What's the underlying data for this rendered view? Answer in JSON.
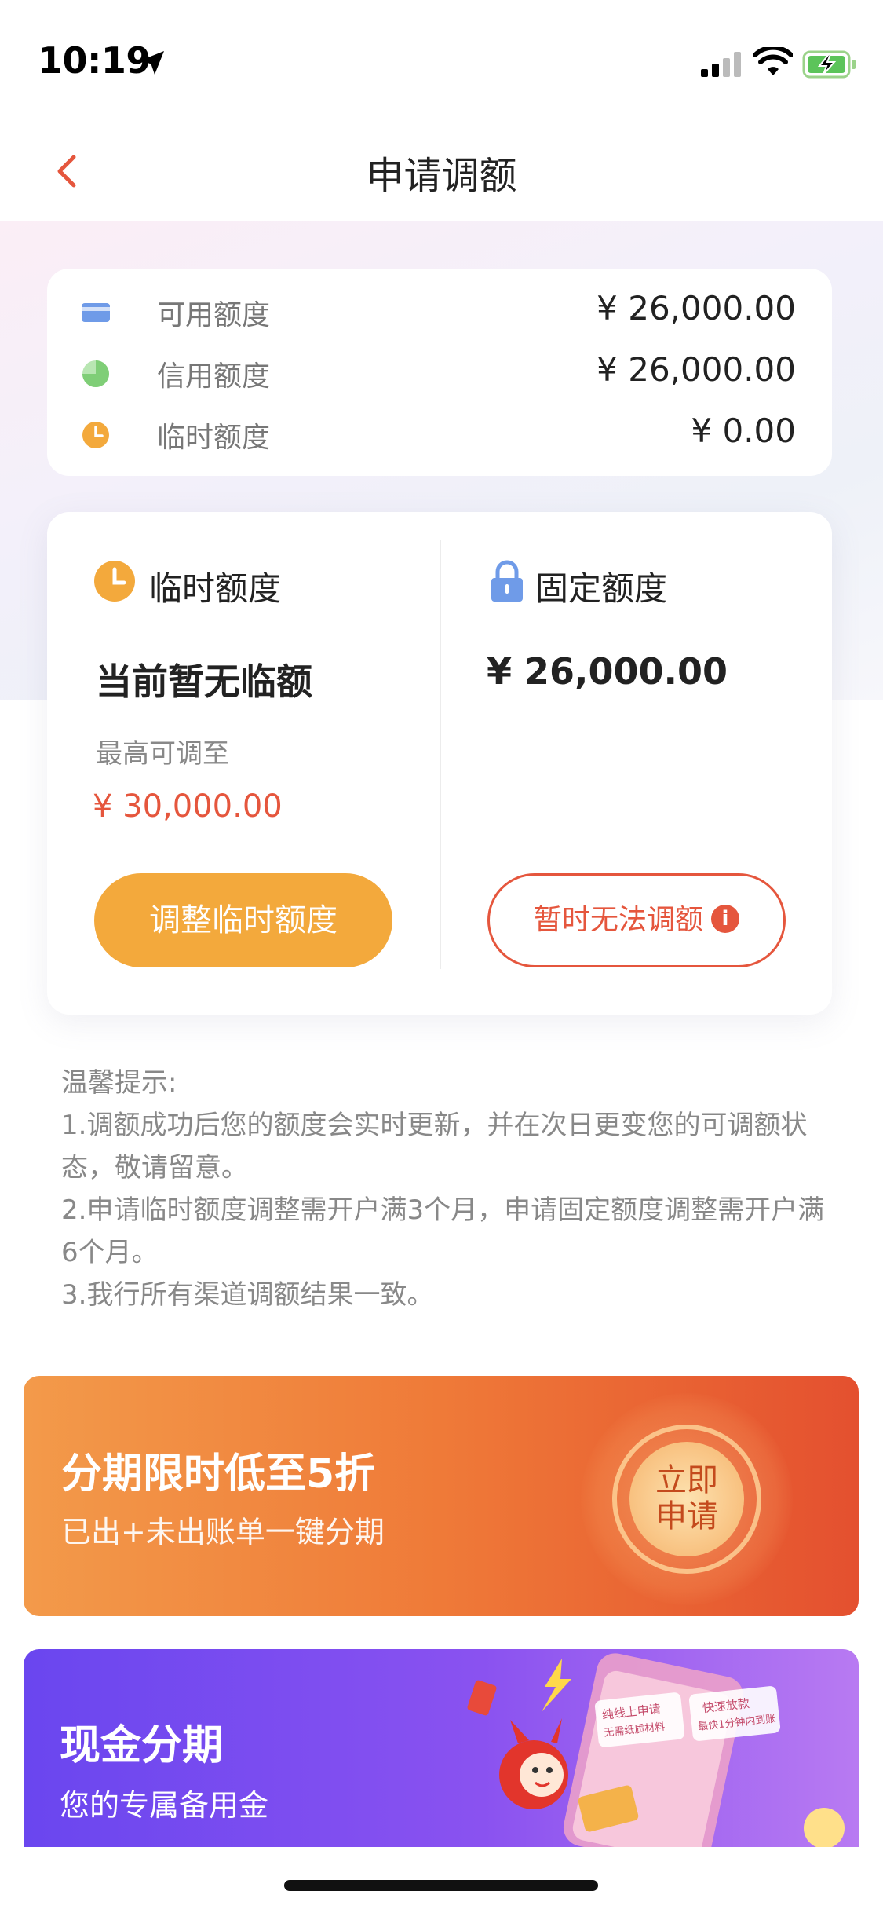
{
  "status_bar": {
    "time": "10:19"
  },
  "nav": {
    "title": "申请调额"
  },
  "summary": {
    "rows": [
      {
        "label": "可用额度",
        "value": "¥ 26,000.00",
        "icon": "card-icon",
        "icon_color": "#6f9be8"
      },
      {
        "label": "信用额度",
        "value": "¥ 26,000.00",
        "icon": "pie-icon",
        "icon_color": "#8fd68a"
      },
      {
        "label": "临时额度",
        "value": "¥ 0.00",
        "icon": "clock-icon",
        "icon_color": "#f3a93c"
      }
    ]
  },
  "temp": {
    "title": "临时额度",
    "status": "当前暂无临额",
    "max_label": "最高可调至",
    "max_value": "¥ 30,000.00",
    "button": "调整临时额度"
  },
  "fixed": {
    "title": "固定额度",
    "value": "¥ 26,000.00",
    "button": "暂时无法调额"
  },
  "tips": {
    "title": "温馨提示:",
    "items": [
      "1.调额成功后您的额度会实时更新，并在次日更变您的可调额状态，敬请留意。",
      "2.申请临时额度调整需开户满3个月，申请固定额度调整需开户满6个月。",
      "3.我行所有渠道调额结果一致。"
    ]
  },
  "banner_installment": {
    "title": "分期限时低至5折",
    "subtitle": "已出+未出账单一键分期",
    "badge_line1": "立即",
    "badge_line2": "申请"
  },
  "banner_cash": {
    "title": "现金分期",
    "subtitle": "您的专属备用金",
    "art_text1": "纯线上申请",
    "art_text2": "无需纸质材料",
    "art_text3": "快速放款",
    "art_text4": "最快1分钟内到账"
  },
  "colors": {
    "accent_orange": "#f3a93c",
    "accent_red": "#e5563d"
  }
}
